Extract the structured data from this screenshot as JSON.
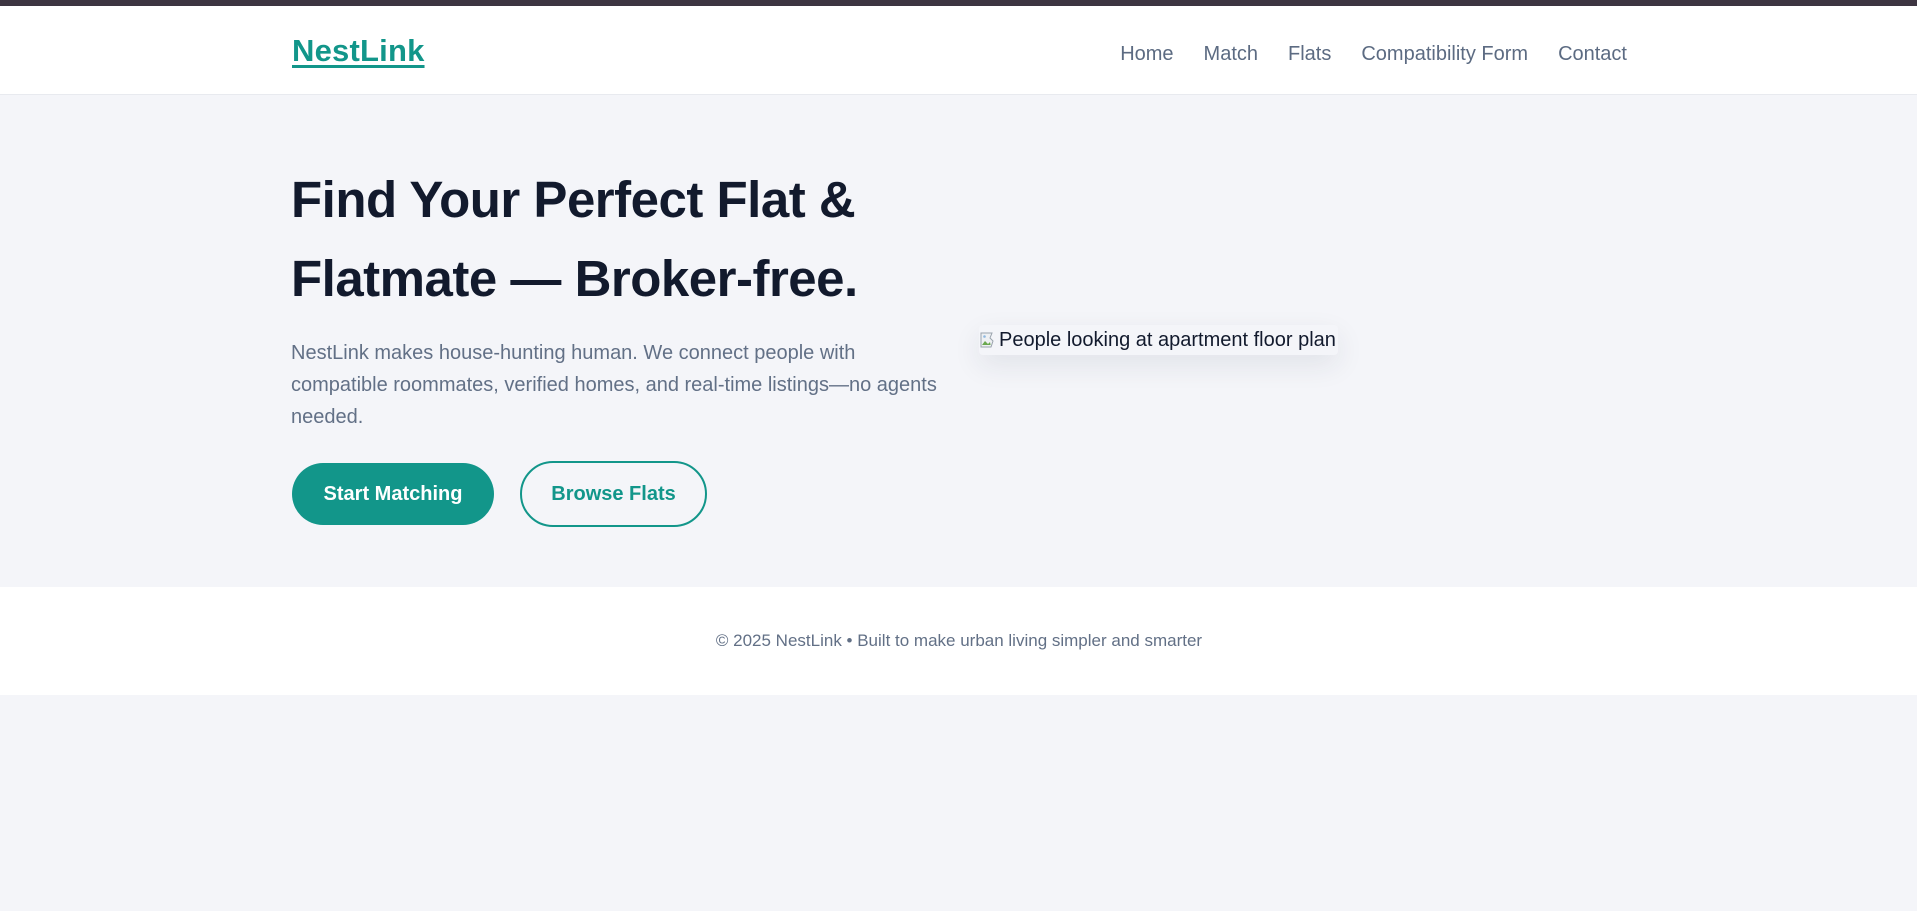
{
  "brand": {
    "name": "NestLink",
    "color": "#12968a"
  },
  "nav": {
    "items": [
      {
        "label": "Home"
      },
      {
        "label": "Match"
      },
      {
        "label": "Flats"
      },
      {
        "label": "Compatibility Form"
      },
      {
        "label": "Contact"
      }
    ]
  },
  "hero": {
    "title": "Find Your Perfect Flat & Flatmate — Broker-free.",
    "description": "NestLink makes house-hunting human. We connect people with compatible roommates, verified homes, and real-time listings—no agents needed.",
    "primary_button": "Start Matching",
    "secondary_button": "Browse Flats",
    "image_alt": "People looking at apartment floor plan",
    "image_icon": "broken-image-icon"
  },
  "footer": {
    "text": "© 2025 NestLink • Built to make urban living simpler and smarter"
  },
  "colors": {
    "accent": "#12968a",
    "heading": "#121a2d",
    "body_text": "#627086",
    "background": "#f4f5f9",
    "topbar": "#3d3541"
  }
}
